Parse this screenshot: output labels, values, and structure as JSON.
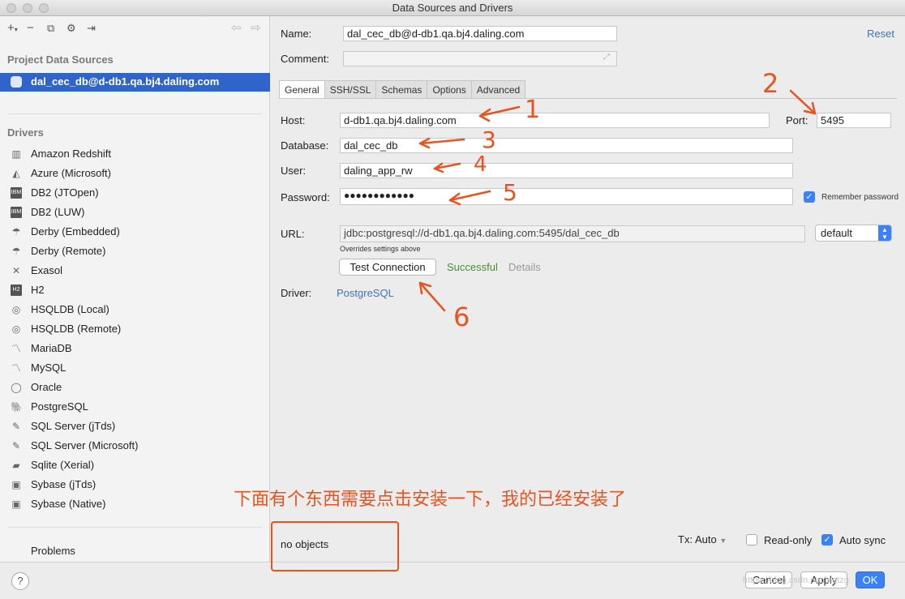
{
  "window": {
    "title": "Data Sources and Drivers"
  },
  "sidebar": {
    "project_section": "Project Data Sources",
    "selected_source": "dal_cec_db@d-db1.qa.bj4.daling.com",
    "drivers_section": "Drivers",
    "drivers": [
      {
        "label": "Amazon Redshift",
        "icon": "redshift-icon"
      },
      {
        "label": "Azure (Microsoft)",
        "icon": "azure-icon"
      },
      {
        "label": "DB2 (JTOpen)",
        "icon": "db2-icon"
      },
      {
        "label": "DB2 (LUW)",
        "icon": "db2-icon"
      },
      {
        "label": "Derby (Embedded)",
        "icon": "derby-icon"
      },
      {
        "label": "Derby (Remote)",
        "icon": "derby-icon"
      },
      {
        "label": "Exasol",
        "icon": "exasol-icon"
      },
      {
        "label": "H2",
        "icon": "h2-icon"
      },
      {
        "label": "HSQLDB (Local)",
        "icon": "hsqldb-icon"
      },
      {
        "label": "HSQLDB (Remote)",
        "icon": "hsqldb-icon"
      },
      {
        "label": "MariaDB",
        "icon": "mariadb-icon"
      },
      {
        "label": "MySQL",
        "icon": "mysql-icon"
      },
      {
        "label": "Oracle",
        "icon": "oracle-icon"
      },
      {
        "label": "PostgreSQL",
        "icon": "postgresql-icon"
      },
      {
        "label": "SQL Server (jTds)",
        "icon": "sqlserver-icon"
      },
      {
        "label": "SQL Server (Microsoft)",
        "icon": "sqlserver-icon"
      },
      {
        "label": "Sqlite (Xerial)",
        "icon": "sqlite-icon"
      },
      {
        "label": "Sybase (jTds)",
        "icon": "sybase-icon"
      },
      {
        "label": "Sybase (Native)",
        "icon": "sybase-icon"
      }
    ],
    "problems": "Problems"
  },
  "form": {
    "name_label": "Name:",
    "name_value": "dal_cec_db@d-db1.qa.bj4.daling.com",
    "reset": "Reset",
    "comment_label": "Comment:",
    "comment_value": "",
    "tabs": [
      "General",
      "SSH/SSL",
      "Schemas",
      "Options",
      "Advanced"
    ],
    "active_tab": "General",
    "host_label": "Host:",
    "host_value": "d-db1.qa.bj4.daling.com",
    "port_label": "Port:",
    "port_value": "5495",
    "database_label": "Database:",
    "database_value": "dal_cec_db",
    "user_label": "User:",
    "user_value": "daling_app_rw",
    "password_label": "Password:",
    "password_value": "●●●●●●●●●●●●",
    "remember_password": "Remember password",
    "url_label": "URL:",
    "url_value": "jdbc:postgresql://d-db1.qa.bj4.daling.com:5495/dal_cec_db",
    "url_mode": "default",
    "overrides_note": "Overrides settings above",
    "test_connection": "Test Connection",
    "test_status": "Successful",
    "details": "Details",
    "driver_label": "Driver:",
    "driver_value": "PostgreSQL",
    "no_objects": "no objects",
    "tx_label": "Tx: Auto",
    "read_only": "Read-only",
    "auto_sync": "Auto sync"
  },
  "footer": {
    "help": "?",
    "cancel": "Cancel",
    "apply": "Apply",
    "ok": "OK",
    "watermark": "https://blog.csdn.net/lnqtzg"
  },
  "annotations": {
    "numbers": [
      "1",
      "2",
      "3",
      "4",
      "5",
      "6"
    ],
    "note": "下面有个东西需要点击安装一下，我的已经安装了",
    "color": "#e8531f"
  },
  "colors": {
    "selection": "#2f65ca",
    "link": "#3a75c4",
    "success": "#4a8f2f",
    "accent": "#3b82f6"
  }
}
